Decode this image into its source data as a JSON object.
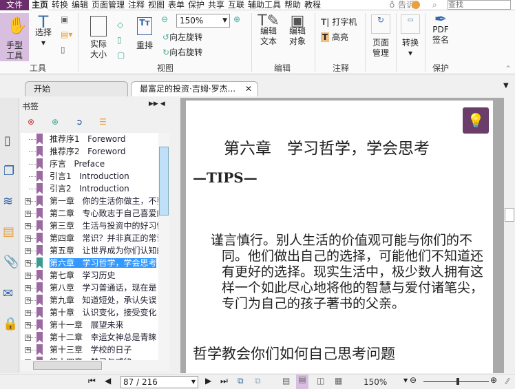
{
  "menu": {
    "file": "文件",
    "items": [
      "主页",
      "转换",
      "编辑",
      "页面管理",
      "注释",
      "视图",
      "表单",
      "保护",
      "共享",
      "互联",
      "辅助工具",
      "帮助",
      "教程"
    ],
    "tell": "告诉",
    "search_placeholder": "查找"
  },
  "ribbon": {
    "hand": "手型\n工具",
    "select": "选择",
    "actual_size": "实际\n大小",
    "reflow": "重排",
    "zoom": "150%",
    "rotate_left": "向左旋转",
    "rotate_right": "向右旋转",
    "edit_text": "编辑\n文本",
    "edit_object": "编辑\n对象",
    "typewriter": "打字机",
    "highlight": "高亮",
    "page_manage": "页面\n管理",
    "convert": "转换",
    "pdf_sign": "PDF\n签名",
    "groups": {
      "tools": "工具",
      "view": "视图",
      "edit": "编辑",
      "comment": "注释",
      "protect": "保护"
    }
  },
  "tabs": [
    {
      "label": "开始"
    },
    {
      "label": "最富足的投资·吉姆·罗杰..."
    }
  ],
  "bookmarks": {
    "title": "书签",
    "items": [
      {
        "cn": "推荐序1",
        "en": "Foreword",
        "exp": false
      },
      {
        "cn": "推荐序2",
        "en": "Foreword",
        "exp": false
      },
      {
        "cn": "序言",
        "en": "Preface",
        "exp": false
      },
      {
        "cn": "引言1",
        "en": "Introduction",
        "exp": false
      },
      {
        "cn": "引言2",
        "en": "Introduction",
        "exp": false
      },
      {
        "cn": "第一章",
        "en": "你的生活你做主，不要",
        "exp": true
      },
      {
        "cn": "第二章",
        "en": "专心致志于自己喜爱的",
        "exp": true
      },
      {
        "cn": "第三章",
        "en": "生活与投资中的好习惯",
        "exp": true
      },
      {
        "cn": "第四章",
        "en": "常识？并非真正的常识",
        "exp": true
      },
      {
        "cn": "第五章",
        "en": "让世界成为你们认知的",
        "exp": true
      },
      {
        "cn": "第六章",
        "en": "学习哲学，学会思考",
        "exp": true,
        "selected": true
      },
      {
        "cn": "第七章",
        "en": "学习历史",
        "exp": true
      },
      {
        "cn": "第八章",
        "en": "学习普通话，现在是",
        "exp": true
      },
      {
        "cn": "第九章",
        "en": "知道短处，承认失误",
        "exp": true
      },
      {
        "cn": "第十章",
        "en": "认识变化，接受变化",
        "exp": true
      },
      {
        "cn": "第十一章",
        "en": "展望未来",
        "exp": true
      },
      {
        "cn": "第十二章",
        "en": "幸运女神总是青睐",
        "exp": true
      },
      {
        "cn": "第十三章",
        "en": "学校的日子",
        "exp": true
      },
      {
        "cn": "第十四章",
        "en": "楚己与戒律",
        "exp": true
      }
    ]
  },
  "page": {
    "chapter": "第六章　学习哲学，学会思考",
    "tips": "—TIPS—",
    "quote": "谨言慎行。别人生活的价值观可能与你们的不同。他们做出自己的选择，可能他们不知道还有更好的选择。现实生活中，极少数人拥有这样一个如此尽心地将他的智慧与爱付诸笔尖，专门为自己的孩子著书的父亲。",
    "heading": "哲学教会你们如何自己思考问题"
  },
  "status": {
    "page": "87 / 216",
    "zoom": "150%",
    "zoom_fraction": 0.5
  }
}
